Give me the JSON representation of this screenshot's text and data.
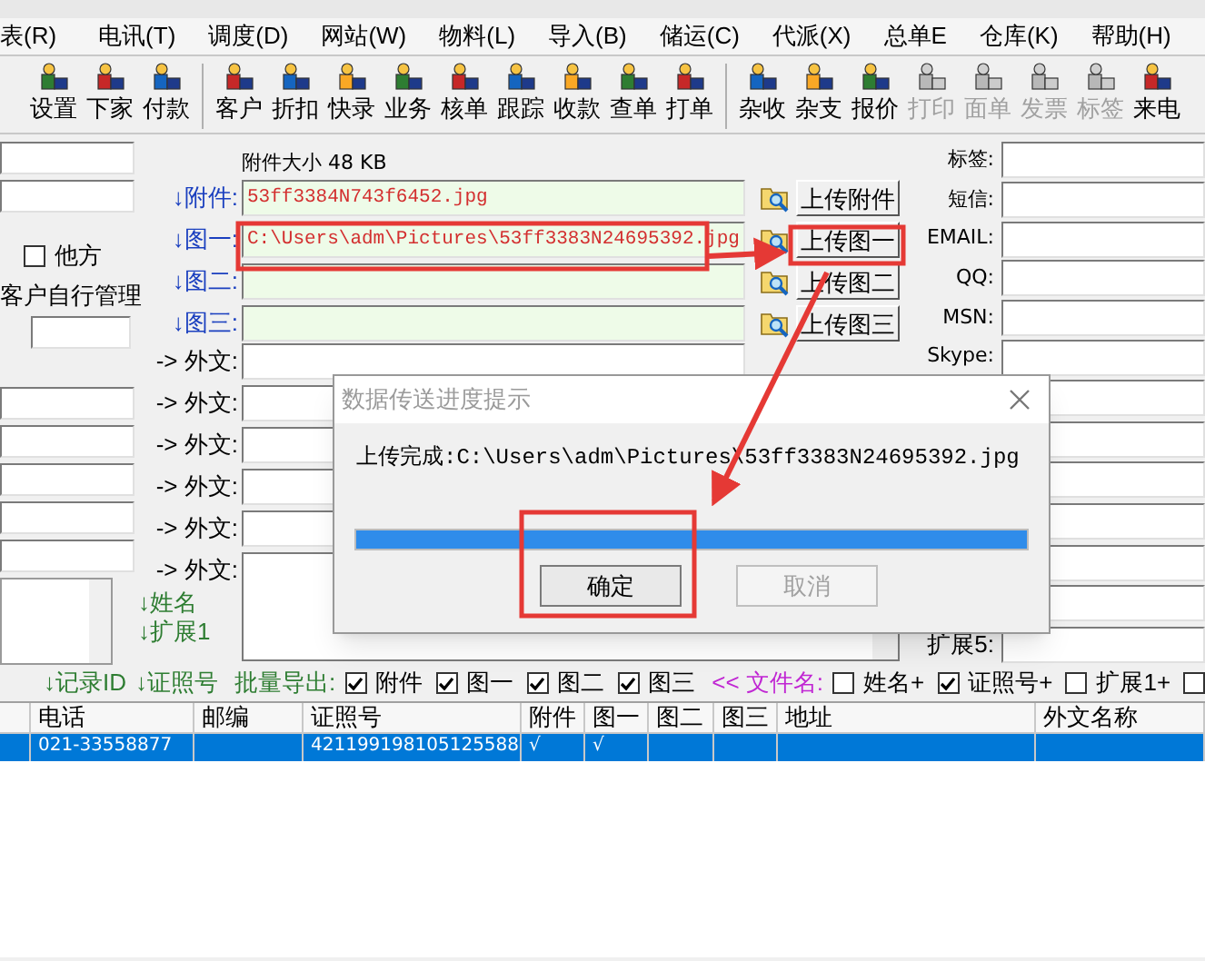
{
  "menu_bar": [
    "表(R)",
    "电讯(T)",
    "调度(D)",
    "网站(W)",
    "物料(L)",
    "导入(B)",
    "储运(C)",
    "代派(X)",
    "总单E",
    "仓库(K)",
    "帮助(H)"
  ],
  "toolbar": [
    [
      {
        "label": "设置",
        "disabled": false
      },
      {
        "label": "下家",
        "disabled": false
      },
      {
        "label": "付款",
        "disabled": false
      }
    ],
    [
      {
        "label": "客户",
        "disabled": false
      },
      {
        "label": "折扣",
        "disabled": false
      },
      {
        "label": "快录",
        "disabled": false
      },
      {
        "label": "业务",
        "disabled": false
      },
      {
        "label": "核单",
        "disabled": false
      },
      {
        "label": "跟踪",
        "disabled": false
      },
      {
        "label": "收款",
        "disabled": false
      },
      {
        "label": "查单",
        "disabled": false
      },
      {
        "label": "打单",
        "disabled": false
      }
    ],
    [
      {
        "label": "杂收",
        "disabled": false
      },
      {
        "label": "杂支",
        "disabled": false
      },
      {
        "label": "报价",
        "disabled": false
      },
      {
        "label": "打印",
        "disabled": true
      },
      {
        "label": "面单",
        "disabled": true
      },
      {
        "label": "发票",
        "disabled": true
      },
      {
        "label": "标签",
        "disabled": true
      },
      {
        "label": "来电",
        "disabled": false
      }
    ]
  ],
  "left_panel": {
    "checkbox": {
      "label": "他方",
      "checked": false
    },
    "note": "客户自行管理"
  },
  "attachment_size": "附件大小 48 KB",
  "file_rows": [
    {
      "label": "↓附件:",
      "value": "53ff3384N743f6452.jpg",
      "button": "上传附件"
    },
    {
      "label": "↓图一:",
      "value": "C:\\Users\\adm\\Pictures\\53ff3383N24695392.jpg",
      "button": "上传图一"
    },
    {
      "label": "↓图二:",
      "button": "上传图二"
    },
    {
      "label": "↓图三:",
      "button": "上传图三"
    }
  ],
  "foreign_rows": [
    "-> 外文:",
    "-> 外文:",
    "-> 外文:",
    "-> 外文:",
    "-> 外文:",
    "-> 外文:"
  ],
  "extra_labels": [
    "↓姓名",
    "↓扩展1"
  ],
  "right_fields_top": [
    "标签:",
    "短信:",
    "EMAIL:",
    "QQ:",
    "MSN:",
    "Skype:"
  ],
  "right_field_bottom": "扩展5:",
  "export_bar": {
    "sort_links": [
      "↓记录ID",
      "↓证照号"
    ],
    "export_label": "批量导出:",
    "export_options": [
      {
        "label": "附件",
        "checked": true
      },
      {
        "label": "图一",
        "checked": true
      },
      {
        "label": "图二",
        "checked": true
      },
      {
        "label": "图三",
        "checked": true
      }
    ],
    "filename_label": "<< 文件名:",
    "filename_options": [
      {
        "label": "姓名+",
        "checked": false
      },
      {
        "label": "证照号+",
        "checked": true
      },
      {
        "label": "扩展1+",
        "checked": false
      },
      {
        "checked": false
      }
    ]
  },
  "table": {
    "columns": [
      "电话",
      "邮编",
      "证照号",
      "附件",
      "图一",
      "图二",
      "图三",
      "地址",
      "外文名称"
    ],
    "rows": [
      {
        "selected": true,
        "cells": [
          "021-33558877",
          null,
          "421199198105125588",
          "√",
          "√",
          null,
          null,
          null,
          null
        ]
      }
    ]
  },
  "dialog": {
    "title": "数据传送进度提示",
    "message": "上传完成:C:\\Users\\adm\\Pictures\\53ff3383N24695392.jpg",
    "progress": {
      "level": 1
    },
    "buttons": [
      {
        "label": "确定",
        "disabled": false
      },
      {
        "label": "取消",
        "disabled": true
      }
    ]
  }
}
